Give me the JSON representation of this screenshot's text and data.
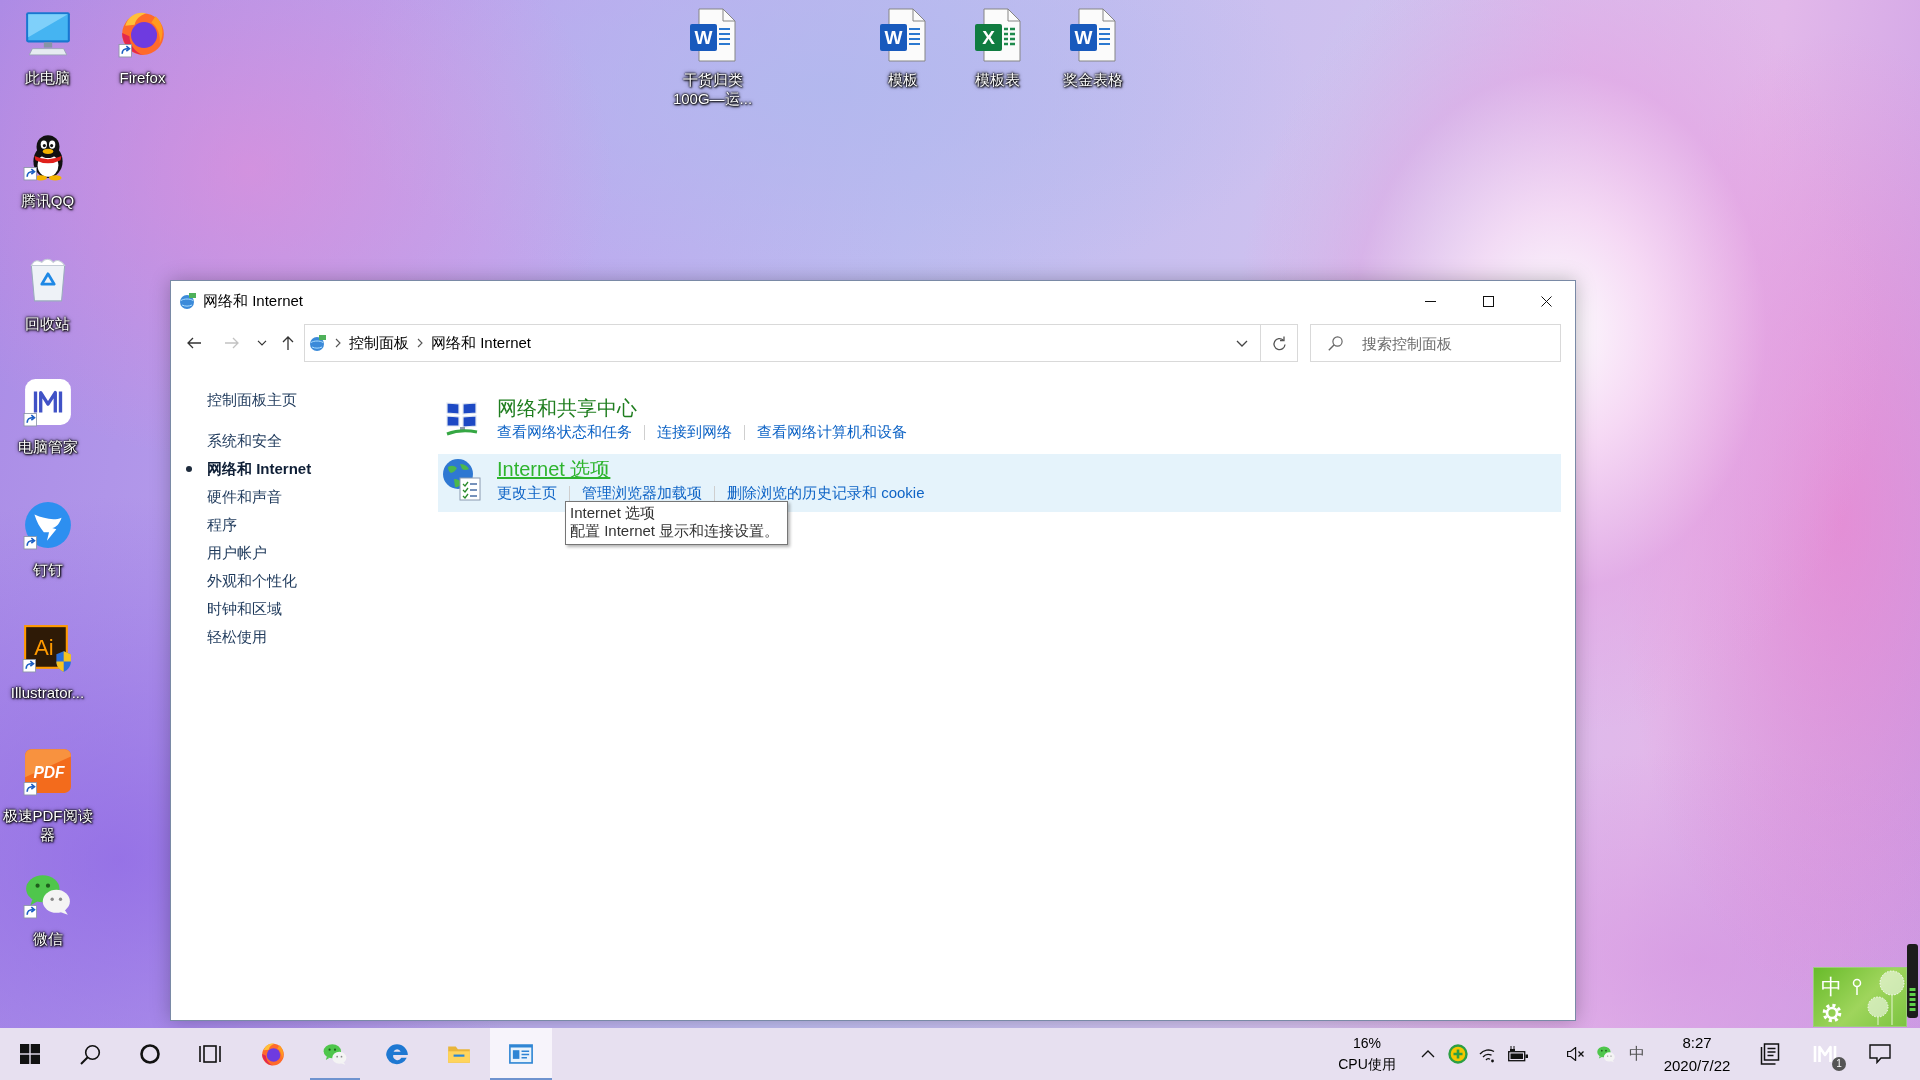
{
  "desktop": {
    "icons": [
      {
        "kind": "computer",
        "label": "此电脑",
        "shortcut": false
      },
      {
        "kind": "penguin",
        "label": "腾讯QQ",
        "shortcut": true
      },
      {
        "kind": "recycle-bin",
        "label": "回收站",
        "shortcut": false
      },
      {
        "kind": "manager",
        "label": "电脑管家",
        "shortcut": true
      },
      {
        "kind": "dingtalk",
        "label": "钉钉",
        "shortcut": true
      },
      {
        "kind": "illustrator",
        "glyph": "Ai",
        "label": "Illustrator...",
        "shortcut": true
      },
      {
        "kind": "pdf",
        "glyph": "PDF",
        "label": "极速PDF阅读器",
        "shortcut": true
      },
      {
        "kind": "wechat",
        "label": "微信",
        "shortcut": true
      },
      {
        "kind": "firefox",
        "label": "Firefox",
        "shortcut": true
      },
      {
        "kind": "word",
        "glyph": "W",
        "label": "干货归类100G—运...",
        "shortcut": false
      },
      {
        "kind": "word",
        "glyph": "W",
        "label": "模板",
        "shortcut": false
      },
      {
        "kind": "excel",
        "glyph": "X",
        "label": "模板表",
        "shortcut": false
      },
      {
        "kind": "word",
        "glyph": "W",
        "label": "奖金表格",
        "shortcut": false
      }
    ]
  },
  "window": {
    "title": "网络和 Internet",
    "nav_buttons": [
      {
        "kind": "back",
        "disabled": false
      },
      {
        "kind": "forward",
        "disabled": true
      },
      {
        "kind": "recent",
        "disabled": false
      },
      {
        "kind": "up",
        "disabled": false
      }
    ],
    "breadcrumbs": [
      "控制面板",
      "网络和 Internet"
    ],
    "search": {
      "placeholder": "搜索控制面板"
    },
    "sidebar": {
      "home": "控制面板主页",
      "items": [
        {
          "label": "系统和安全",
          "selected": false
        },
        {
          "label": "网络和 Internet",
          "selected": true
        },
        {
          "label": "硬件和声音",
          "selected": false
        },
        {
          "label": "程序",
          "selected": false
        },
        {
          "label": "用户帐户",
          "selected": false
        },
        {
          "label": "外观和个性化",
          "selected": false
        },
        {
          "label": "时钟和区域",
          "selected": false
        },
        {
          "label": "轻松使用",
          "selected": false
        }
      ]
    },
    "categories": [
      {
        "kind": "network",
        "title": "网络和共享中心",
        "hovered": false,
        "links": [
          "查看网络状态和任务",
          "连接到网络",
          "查看网络计算机和设备"
        ]
      },
      {
        "kind": "globe",
        "title": "Internet 选项",
        "hovered": true,
        "links": [
          "更改主页",
          "管理浏览器加载项",
          "删除浏览的历史记录和 cookie"
        ],
        "tooltip": {
          "title": "Internet 选项",
          "text": "配置 Internet 显示和连接设置。"
        }
      }
    ]
  },
  "ime_toolbar": {
    "mode": "中"
  },
  "taskbar": {
    "buttons": [
      {
        "kind": "start"
      },
      {
        "kind": "search"
      },
      {
        "kind": "cortana"
      },
      {
        "kind": "taskview"
      }
    ],
    "apps": [
      {
        "kind": "firefox",
        "running": false,
        "selected": false
      },
      {
        "kind": "wechat",
        "running": true,
        "selected": false
      },
      {
        "kind": "edge",
        "running": false,
        "selected": false
      },
      {
        "kind": "explorer",
        "running": false,
        "selected": false
      },
      {
        "kind": "controlpanel",
        "running": true,
        "selected": true
      }
    ],
    "cpu": {
      "value": "16%",
      "label": "CPU使用"
    },
    "tray": [
      {
        "kind": "chevron"
      },
      {
        "kind": "security"
      },
      {
        "kind": "wifi"
      },
      {
        "kind": "battery"
      },
      {
        "kind": "mute"
      },
      {
        "kind": "wechat"
      },
      {
        "kind": "ime",
        "text": "中"
      }
    ],
    "clock": {
      "time": "8:27",
      "date": "2020/7/22"
    },
    "corner": [
      {
        "kind": "notes"
      },
      {
        "kind": "manager",
        "badge": "1"
      },
      {
        "kind": "notifications"
      }
    ]
  }
}
